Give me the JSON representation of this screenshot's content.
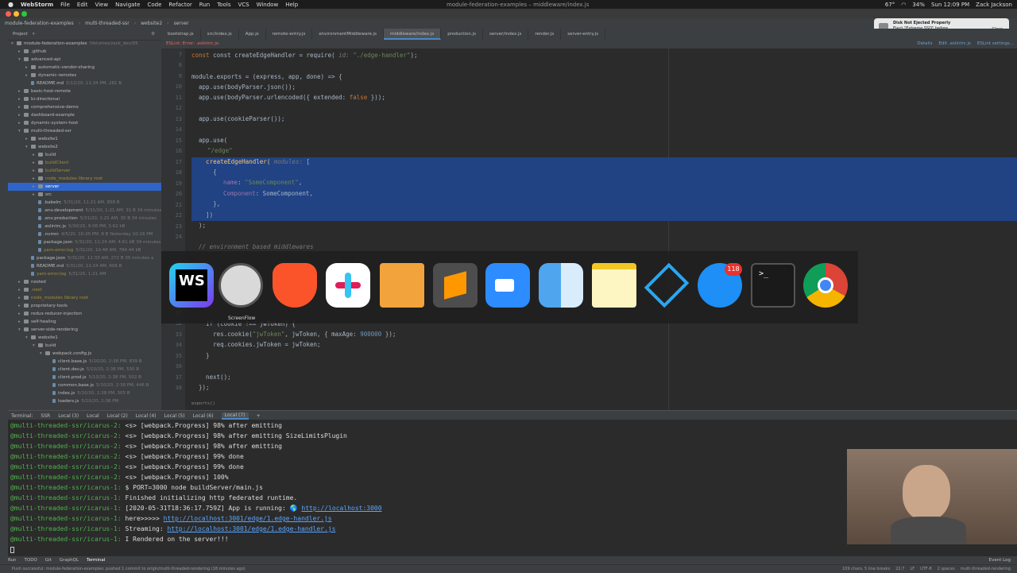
{
  "menubar": {
    "app": "WebStorm",
    "items": [
      "File",
      "Edit",
      "View",
      "Navigate",
      "Code",
      "Refactor",
      "Run",
      "Tools",
      "VCS",
      "Window",
      "Help"
    ],
    "window_title": "module-federation-examples – middleware/index.js",
    "battery": "34%",
    "clock": "Sun 12:09 PM",
    "user": "Zack Jackson",
    "cpu": "67°"
  },
  "breadcrumb": [
    "module-federation-examples",
    "multi-threaded-ssr",
    "website2",
    "server"
  ],
  "project": {
    "title": "Project",
    "root_path": "/Volumes/zack_dev/05",
    "nodes": [
      {
        "label": "module-federation-examples",
        "depth": 0,
        "arrow": "▾",
        "type": "folder"
      },
      {
        "label": ".github",
        "depth": 1,
        "arrow": "▸",
        "type": "folder"
      },
      {
        "label": "advanced-api",
        "depth": 1,
        "arrow": "▾",
        "type": "folder"
      },
      {
        "label": "automatic-vendor-sharing",
        "depth": 2,
        "arrow": "▸",
        "type": "folder"
      },
      {
        "label": "dynamic-remotes",
        "depth": 2,
        "arrow": "▸",
        "type": "folder"
      },
      {
        "label": "README.md",
        "depth": 2,
        "arrow": "",
        "type": "file",
        "meta": "5/12/20, 11:34 PM, 281 B"
      },
      {
        "label": "basic-host-remote",
        "depth": 1,
        "arrow": "▸",
        "type": "folder"
      },
      {
        "label": "bi-directional",
        "depth": 1,
        "arrow": "▸",
        "type": "folder"
      },
      {
        "label": "comprehensive-demo",
        "depth": 1,
        "arrow": "▸",
        "type": "folder"
      },
      {
        "label": "dashboard-example",
        "depth": 1,
        "arrow": "▸",
        "type": "folder"
      },
      {
        "label": "dynamic-system-host",
        "depth": 1,
        "arrow": "▸",
        "type": "folder"
      },
      {
        "label": "multi-threaded-ssr",
        "depth": 1,
        "arrow": "▾",
        "type": "folder"
      },
      {
        "label": "website1",
        "depth": 2,
        "arrow": "▸",
        "type": "folder"
      },
      {
        "label": "website2",
        "depth": 2,
        "arrow": "▾",
        "type": "folder"
      },
      {
        "label": "build",
        "depth": 3,
        "arrow": "▸",
        "type": "folder"
      },
      {
        "label": "buildClient",
        "depth": 3,
        "arrow": "▸",
        "type": "folder",
        "ignored": true
      },
      {
        "label": "buildServer",
        "depth": 3,
        "arrow": "▸",
        "type": "folder",
        "ignored": true
      },
      {
        "label": "node_modules  library root",
        "depth": 3,
        "arrow": "▸",
        "type": "folder",
        "ignored": true
      },
      {
        "label": "server",
        "depth": 3,
        "arrow": "▸",
        "type": "folder",
        "selected": true
      },
      {
        "label": "src",
        "depth": 3,
        "arrow": "▸",
        "type": "folder"
      },
      {
        "label": ".babelrc",
        "depth": 3,
        "arrow": "",
        "type": "file",
        "meta": "5/31/20, 11:21 AM, 858 B"
      },
      {
        "label": ".env.development",
        "depth": 3,
        "arrow": "",
        "type": "file",
        "meta": "5/31/20, 1:21 AM, 31 B  34 minutes"
      },
      {
        "label": ".env.production",
        "depth": 3,
        "arrow": "",
        "type": "file",
        "meta": "5/31/20, 1:21 AM, 30 B  34 minutes"
      },
      {
        "label": ".eslintrc.js",
        "depth": 3,
        "arrow": "",
        "type": "file",
        "meta": "5/30/20, 9:06 PM, 3.62 kB"
      },
      {
        "label": ".nvmrc",
        "depth": 3,
        "arrow": "",
        "type": "file",
        "meta": "4/5/20, 10:35 PM, 8 B  Yesterday 10:16 PM"
      },
      {
        "label": "package.json",
        "depth": 3,
        "arrow": "",
        "type": "file",
        "meta": "5/31/20, 11:24 AM, 4.61 kB  34 minutes"
      },
      {
        "label": "yarn-error.log",
        "depth": 3,
        "arrow": "",
        "type": "file",
        "meta": "5/31/20, 10:48 AM, 784.44 kB",
        "ignored": true
      },
      {
        "label": "package.json",
        "depth": 2,
        "arrow": "",
        "type": "file",
        "meta": "5/31/20, 11:33 AM, 272 B  35 minutes a"
      },
      {
        "label": "README.md",
        "depth": 2,
        "arrow": "",
        "type": "file",
        "meta": "5/31/20, 11:24 AM, 606 B"
      },
      {
        "label": "yarn-error.log",
        "depth": 2,
        "arrow": "",
        "type": "file",
        "meta": "5/31/20, 1:21 AM",
        "ignored": true
      },
      {
        "label": "nested",
        "depth": 1,
        "arrow": "▸",
        "type": "folder"
      },
      {
        "label": ".next",
        "depth": 1,
        "arrow": "▸",
        "type": "folder",
        "ignored": true
      },
      {
        "label": "node_modules  library root",
        "depth": 1,
        "arrow": "▸",
        "type": "folder",
        "ignored": true
      },
      {
        "label": "proprietary-tools",
        "depth": 1,
        "arrow": "▸",
        "type": "folder"
      },
      {
        "label": "redux-reducer-injection",
        "depth": 1,
        "arrow": "▸",
        "type": "folder"
      },
      {
        "label": "self-healing",
        "depth": 1,
        "arrow": "▸",
        "type": "folder"
      },
      {
        "label": "server-side-rendering",
        "depth": 1,
        "arrow": "▾",
        "type": "folder"
      },
      {
        "label": "website1",
        "depth": 2,
        "arrow": "▾",
        "type": "folder"
      },
      {
        "label": "build",
        "depth": 3,
        "arrow": "▾",
        "type": "folder"
      },
      {
        "label": "webpack.config.js",
        "depth": 4,
        "arrow": "▾",
        "type": "folder"
      },
      {
        "label": "client.base.js",
        "depth": 5,
        "arrow": "",
        "type": "file",
        "meta": "5/10/20, 2:38 PM, 839 B"
      },
      {
        "label": "client.dev.js",
        "depth": 5,
        "arrow": "",
        "type": "file",
        "meta": "5/10/20, 2:38 PM, 530 B"
      },
      {
        "label": "client.prod.js",
        "depth": 5,
        "arrow": "",
        "type": "file",
        "meta": "5/10/20, 2:38 PM, 502 B"
      },
      {
        "label": "common.base.js",
        "depth": 5,
        "arrow": "",
        "type": "file",
        "meta": "5/10/20, 2:38 PM, 446 B"
      },
      {
        "label": "index.js",
        "depth": 5,
        "arrow": "",
        "type": "file",
        "meta": "5/10/20, 2:38 PM, 305 B"
      },
      {
        "label": "loaders.js",
        "depth": 5,
        "arrow": "",
        "type": "file",
        "meta": "5/10/20, 2:38 PM"
      }
    ]
  },
  "tabs": [
    {
      "label": "bootstrap.js"
    },
    {
      "label": "src/index.js"
    },
    {
      "label": "App.js"
    },
    {
      "label": "remote-entry.js"
    },
    {
      "label": "environmentMiddleware.js"
    },
    {
      "label": "middleware/index.js",
      "active": true
    },
    {
      "label": "production.js"
    },
    {
      "label": "server/index.js"
    },
    {
      "label": "render.js"
    },
    {
      "label": "server-entry.js"
    }
  ],
  "lint": {
    "error": "ESLint: Error: .eslintrc.js:",
    "details": "Details",
    "edit": "Edit .eslintrc.js",
    "settings": "ESLint settings..."
  },
  "editor": {
    "line_numbers": [
      "7",
      "8",
      "9",
      "10",
      "11",
      "12",
      "13",
      "14",
      "15",
      "16",
      "17",
      "18",
      "19",
      "20",
      "21",
      "22",
      "23",
      "24"
    ],
    "lower_line_numbers": [
      "31",
      "32",
      "33",
      "34",
      "35",
      "36",
      "37",
      "38"
    ],
    "breadcrumb": "exports()",
    "code": {
      "l7": "const createEdgeHandler = require(",
      "l7_hint": "id:",
      "l7_str": "\"./edge-handler\"",
      "l7_end": ");",
      "l9": "module.exports = (express, app, done) => {",
      "l10": "  app.use(bodyParser.json());",
      "l11a": "  app.use(bodyParser.urlencoded({ extended: ",
      "l11b": "false",
      "l11c": " }));",
      "l13": "  app.use(cookieParser());",
      "l15": "  app.use(",
      "l16": "\"/edge\"",
      "l17a": "    createEdgeHandler(",
      "l17_hint": "modules:",
      "l17b": " [",
      "l18": "      {",
      "l19a": "name",
      "l19b": "\"SomeComponent\"",
      "l20a": "Component",
      "l20b": ": SomeComponent,",
      "l21": "      },",
      "l22": "    ])",
      "l23": "  );",
      "l24": "  // environment based middlewares",
      "l32": "    if (cookie !== jwToken) {",
      "l33a": "      res.cookie(",
      "l33b": "\"jwToken\"",
      "l33c": ", jwToken, { maxAge: ",
      "l33d": "900000",
      "l33e": " });",
      "l34": "      req.cookies.jwToken = jwToken;",
      "l35": "    }",
      "l37": "    next();",
      "l38": "  });"
    }
  },
  "dock": {
    "screenflow_label": "ScreenFlow",
    "ws_label": "WS",
    "messages_badge": "118",
    "apps": [
      "webstorm-icon",
      "screenflow-icon",
      "brave-icon",
      "slack-icon",
      "pages-icon",
      "sublime-icon",
      "zoom-icon",
      "finder-icon",
      "notes-icon",
      "vscode-icon",
      "messages-icon",
      "terminal-icon",
      "chrome-icon"
    ]
  },
  "terminal": {
    "label": "Terminal:",
    "tabs": [
      "SSR",
      "Local (3)",
      "Local",
      "Local (2)",
      "Local (4)",
      "Local (5)",
      "Local (6)",
      "Local (7)"
    ],
    "active_tab": "Local (7)",
    "lines": [
      {
        "prompt": "@multi-threaded-ssr/icarus-2:",
        "text": " <s> [webpack.Progress] 98% after emitting"
      },
      {
        "prompt": "@multi-threaded-ssr/icarus-2:",
        "text": " <s> [webpack.Progress] 98% after emitting SizeLimitsPlugin"
      },
      {
        "prompt": "@multi-threaded-ssr/icarus-2:",
        "text": " <s> [webpack.Progress] 98% after emitting"
      },
      {
        "prompt": "@multi-threaded-ssr/icarus-2:",
        "text": " <s> [webpack.Progress] 99% done"
      },
      {
        "prompt": "@multi-threaded-ssr/icarus-2:",
        "text": " <s> [webpack.Progress] 99% done"
      },
      {
        "prompt": "@multi-threaded-ssr/icarus-2:",
        "text": " <s> [webpack.Progress] 100%"
      },
      {
        "prompt": "@multi-threaded-ssr/icarus-1:",
        "text": " $ PORT=3000 node buildServer/main.js"
      },
      {
        "prompt": "@multi-threaded-ssr/icarus-1:",
        "text": " Finished initializing http federated runtime."
      },
      {
        "prompt": "@multi-threaded-ssr/icarus-1:",
        "text": " [2020-05-31T18:36:17.759Z] App is running: 🌎 ",
        "link": "http://localhost:3000"
      },
      {
        "prompt": "@multi-threaded-ssr/icarus-1:",
        "text": " here>>>>> ",
        "link": "http://localhost:3001/edge/1.edge-handler.js"
      },
      {
        "prompt": "@multi-threaded-ssr/icarus-1:",
        "text": " Streaming: ",
        "link": "http://localhost:3001/edge/1.edge-handler.js"
      },
      {
        "prompt": "@multi-threaded-ssr/icarus-1:",
        "text": " I Rendered on the server!!!"
      }
    ]
  },
  "toolwindows": [
    "Run",
    "TODO",
    "Git",
    "GraphQL",
    "Terminal"
  ],
  "statusbar": {
    "message": "Push successful: module-federation-examples: pushed 1 commit to origin/multi-threaded-rendering (18 minutes ago)",
    "chars": "109 chars, 5 line breaks",
    "pos": "22:7",
    "lf": "LF",
    "enc": "UTF-8",
    "indent": "2 spaces",
    "branch": "multi-threaded-rendering",
    "event_log": "Event Log"
  },
  "notification": {
    "title": "Disk Not Ejected Properly",
    "body": "Eject \"Extreme SSD\" before disconnecting or turning it off.",
    "close": "Close"
  }
}
